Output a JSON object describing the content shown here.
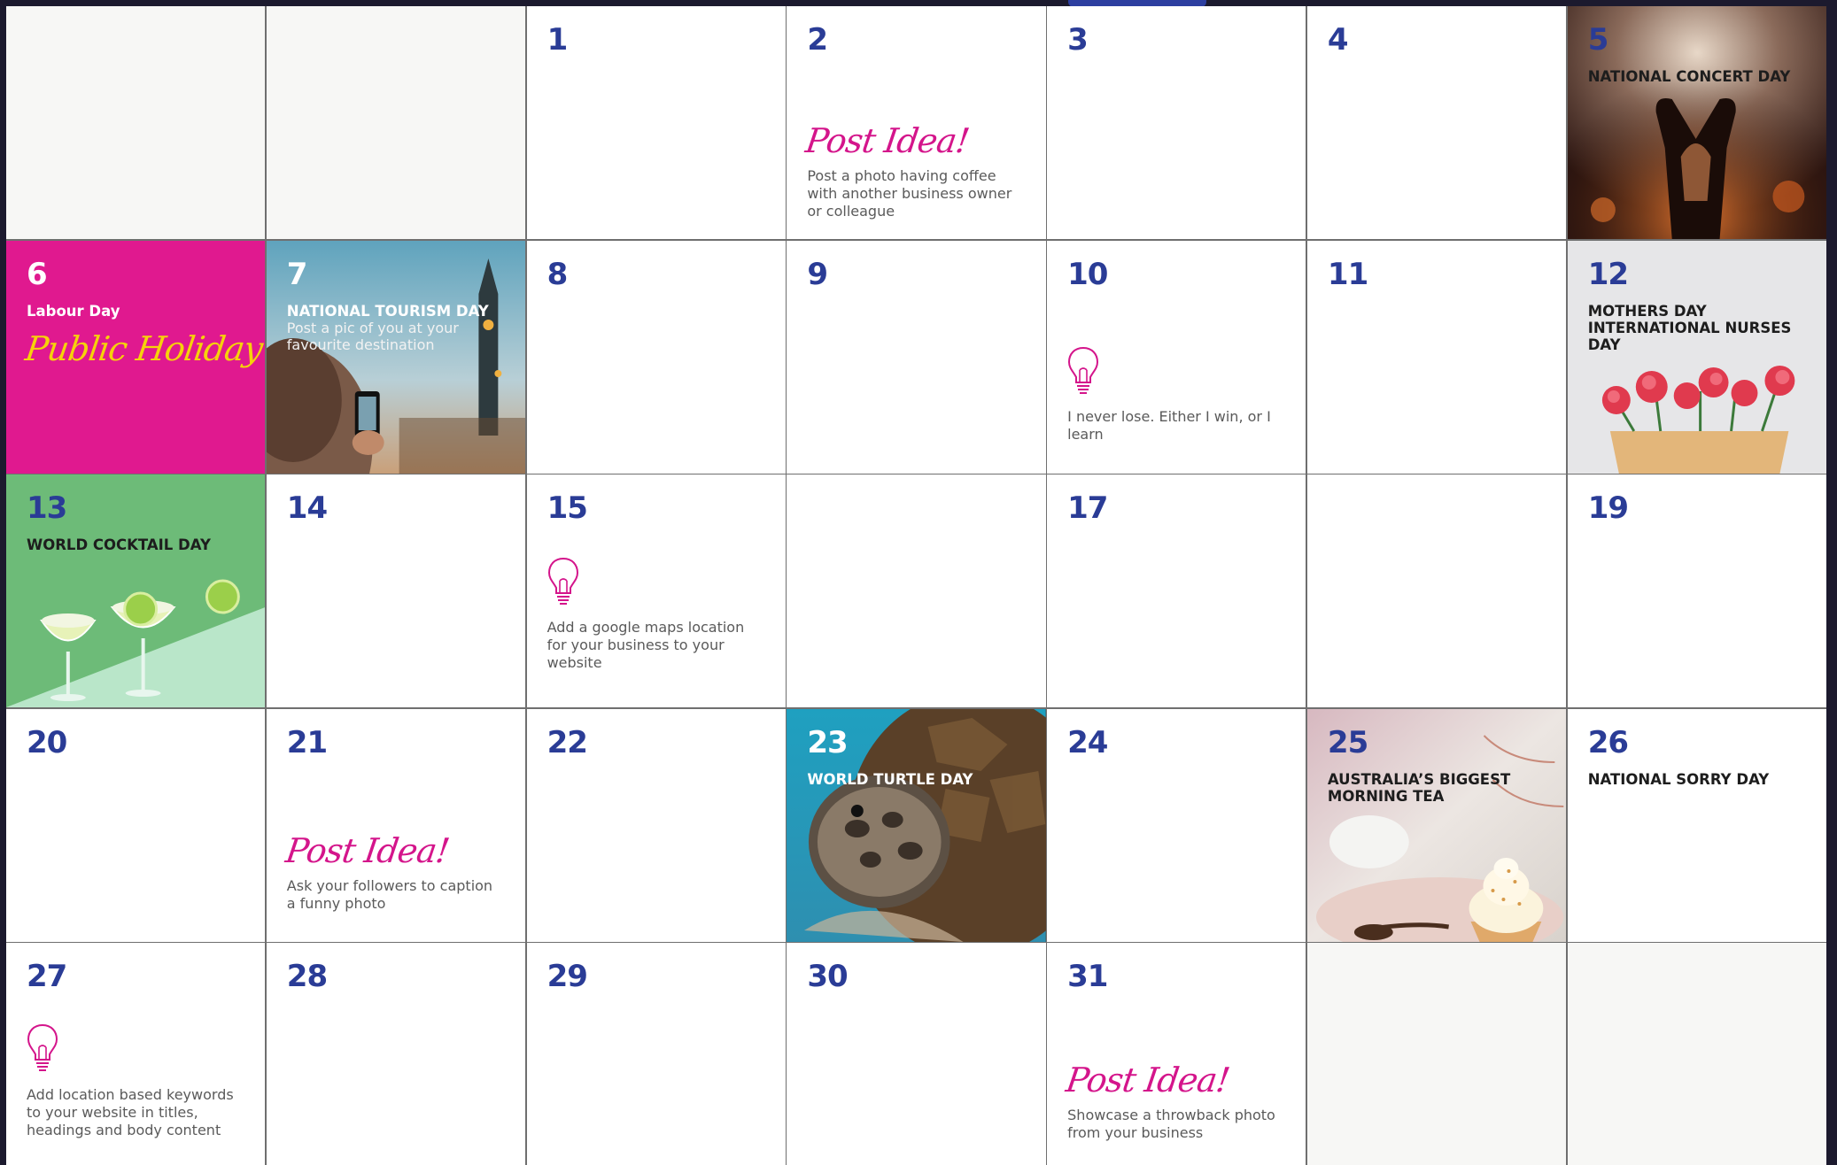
{
  "calendar": {
    "colors": {
      "day_number": "#2a3c96",
      "accent_pink": "#e0198f",
      "script_pink": "#d4158b",
      "script_yellow": "#f6d20a",
      "cocktail_green": "#6dbb78"
    },
    "days": {
      "d1": "1",
      "d2": "2",
      "d3": "3",
      "d4": "4",
      "d5": "5",
      "d6": "6",
      "d7": "7",
      "d8": "8",
      "d9": "9",
      "d10": "10",
      "d11": "11",
      "d12": "12",
      "d13": "13",
      "d14": "14",
      "d15": "15",
      "d17": "17",
      "d19": "19",
      "d20": "20",
      "d21": "21",
      "d22": "22",
      "d23": "23",
      "d24": "24",
      "d25": "25",
      "d26": "26",
      "d27": "27",
      "d28": "28",
      "d29": "29",
      "d30": "30",
      "d31": "31"
    },
    "events": {
      "d5": "NATIONAL CONCERT DAY",
      "d6": "Labour Day",
      "d6_script": "Public Holiday",
      "d7": "NATIONAL TOURISM DAY",
      "d7_sub": "Post a pic of you at your favourite destination",
      "d12": "MOTHERS DAY INTERNATIONAL NURSES DAY",
      "d13": "WORLD COCKTAIL DAY",
      "d23": "WORLD TURTLE DAY",
      "d25": "AUSTRALIA’S BIGGEST MORNING TEA",
      "d26": "NATIONAL SORRY DAY"
    },
    "ideas": {
      "post_idea_label": "Post Idea!",
      "d2": "Post a photo having coffee with another business owner or colleague",
      "d10": "I never lose. Either I win, or I learn",
      "d15": "Add a google maps location for your business to your website",
      "d21": "Ask your followers to caption a funny photo",
      "d27": "Add location based keywords to your website in titles, headings and body content",
      "d31": "Showcase a throwback photo from your business"
    },
    "icons": [
      "lightbulb-icon"
    ]
  }
}
